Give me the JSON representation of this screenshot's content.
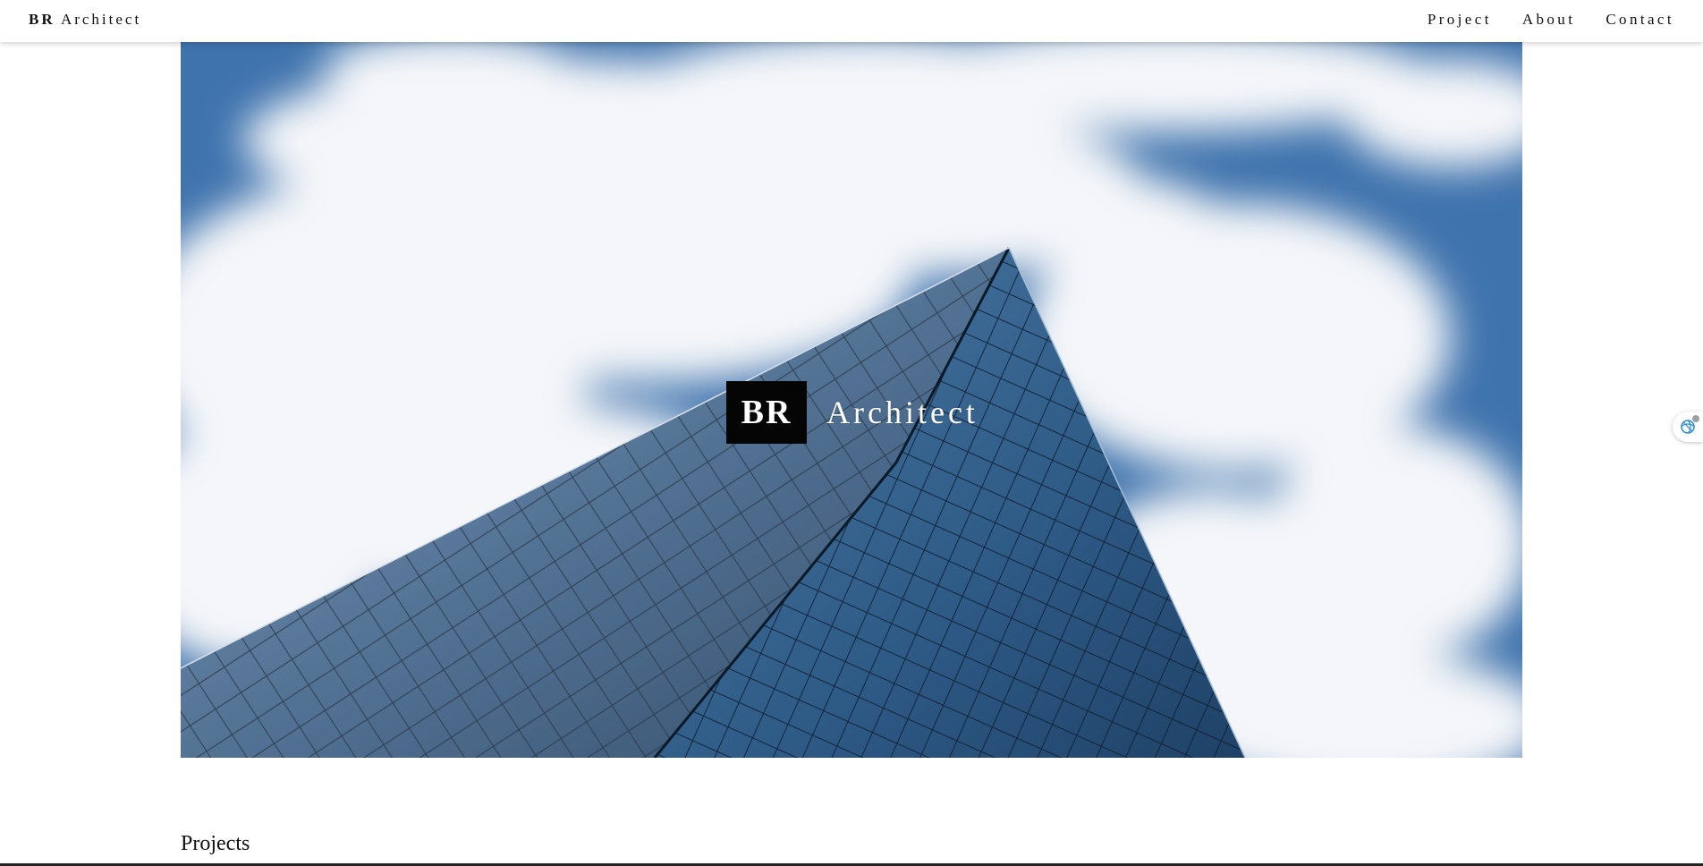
{
  "header": {
    "brand_bold": "BR",
    "brand_rest": "Architect",
    "nav": [
      {
        "label": "Project"
      },
      {
        "label": "About"
      },
      {
        "label": "Contact"
      }
    ]
  },
  "hero": {
    "logo_box": "BR",
    "logo_word": "Architect",
    "image_subject": "glass-skyscraper-against-cloudy-sky"
  },
  "sections": {
    "projects_heading": "Projects"
  },
  "side_widget": {
    "icon": "assistant-swirl-icon"
  },
  "colors": {
    "sky_blue": "#3f73ad",
    "cloud_white": "#f4f6f9",
    "glass_dark": "#1f3a55",
    "logo_bg": "#050505"
  }
}
